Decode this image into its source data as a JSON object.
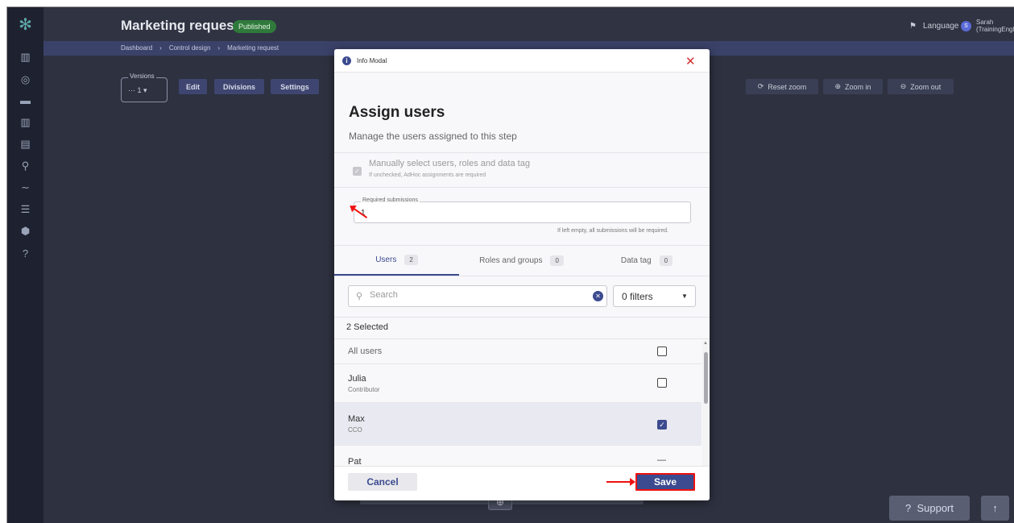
{
  "app": {
    "page_title": "Marketing request",
    "status_badge": "Published",
    "language_label": "Language",
    "user_initial": "S",
    "user_name": "Sarah",
    "user_context": "(TrainingEnglish)"
  },
  "breadcrumb": [
    "Dashboard",
    "Control design",
    "Marketing request"
  ],
  "toolbar": {
    "versions_label": "Versions",
    "versions_value": "1",
    "edit": "Edit",
    "divisions": "Divisions",
    "settings": "Settings",
    "reset_zoom": "Reset zoom",
    "zoom_in": "Zoom in",
    "zoom_out": "Zoom out"
  },
  "modal": {
    "type_label": "Info Modal",
    "title": "Assign users",
    "subtitle": "Manage the users assigned to this step",
    "manual_select_label": "Manually select users, roles and data tag",
    "manual_select_help": "If unchecked, AdHoc assignments are required",
    "required_submissions_label": "Required submissions",
    "required_submissions_value": "1",
    "required_submissions_help": "If left empty, all submissions will be required.",
    "tabs": [
      {
        "label": "Users",
        "count": "2"
      },
      {
        "label": "Roles and groups",
        "count": "0"
      },
      {
        "label": "Data tag",
        "count": "0"
      }
    ],
    "search_placeholder": "Search",
    "filters_label": "0 filters",
    "selected_count": "2 Selected",
    "rows": [
      {
        "name": "All users",
        "role": "",
        "checked": false
      },
      {
        "name": "Julia",
        "role": "Contributor",
        "checked": false
      },
      {
        "name": "Max",
        "role": "CCO",
        "checked": true
      },
      {
        "name": "Pat",
        "role": "",
        "checked": false
      }
    ],
    "cancel": "Cancel",
    "save": "Save"
  },
  "footer": {
    "support": "Support"
  },
  "colors": {
    "background": "#2e3140",
    "accent": "#3c4b8f",
    "badge_green": "#2f7a3b",
    "annotation_red": "#e11111"
  }
}
